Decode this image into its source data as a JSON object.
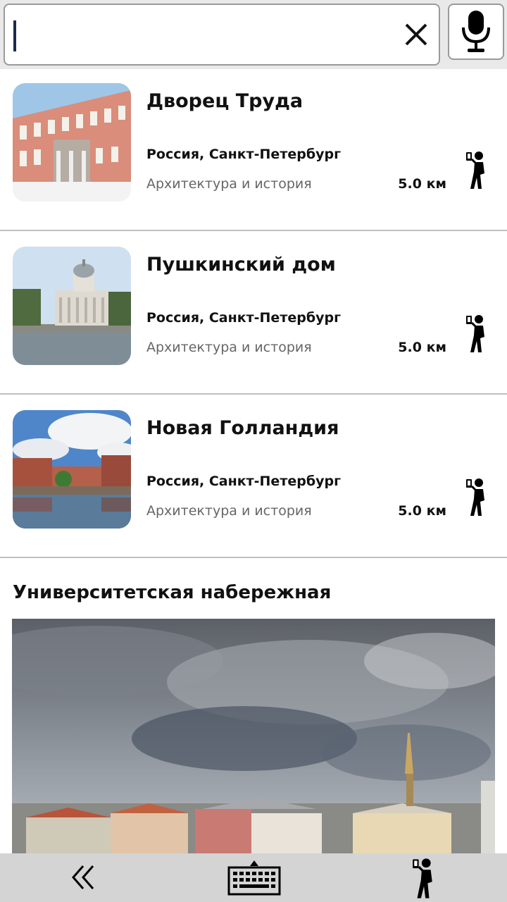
{
  "search": {
    "value": "",
    "placeholder": ""
  },
  "results": [
    {
      "title": "Дворец Труда",
      "location": "Россия, Санкт-Петербург",
      "category": "Архитектура и история",
      "distance": "5.0 км"
    },
    {
      "title": "Пушкинский дом",
      "location": "Россия, Санкт-Петербург",
      "category": "Архитектура и история",
      "distance": "5.0 км"
    },
    {
      "title": "Новая Голландия",
      "location": "Россия, Санкт-Петербург",
      "category": "Архитектура и история",
      "distance": "5.0 км"
    }
  ],
  "featured": {
    "title": "Университетская набережная"
  },
  "icons": {
    "clear": "close-icon",
    "mic": "microphone-icon",
    "walk": "pedestrian-with-phone-icon",
    "back": "double-chevron-left-icon",
    "keyboard": "keyboard-icon"
  },
  "colors": {
    "caret": "#1a2c4d",
    "nav_bg": "#d4d4d4",
    "divider": "#bfbfbf"
  }
}
